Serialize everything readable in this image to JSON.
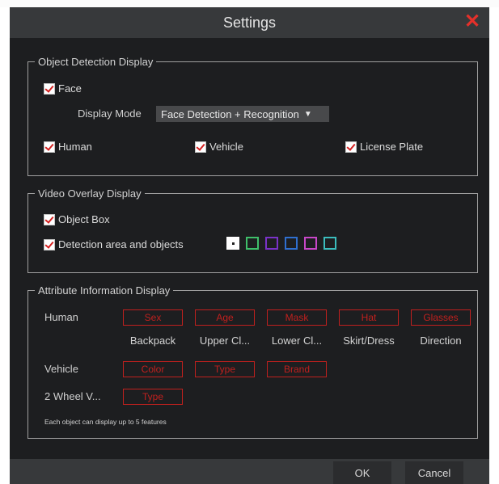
{
  "dialog": {
    "title": "Settings",
    "close_symbol": "✕"
  },
  "object_detection": {
    "legend": "Object Detection Display",
    "face_label": "Face",
    "display_mode_label": "Display Mode",
    "display_mode_value": "Face Detection + Recognition",
    "human_label": "Human",
    "vehicle_label": "Vehicle",
    "license_plate_label": "License Plate"
  },
  "video_overlay": {
    "legend": "Video Overlay Display",
    "object_box_label": "Object Box",
    "detection_area_label": "Detection area and objects",
    "swatch_colors": [
      "#ffffff",
      "#3fbf6a",
      "#7a32c8",
      "#2f6fd0",
      "#c847c8",
      "#3bbdbd"
    ]
  },
  "attributes": {
    "legend": "Attribute Information Display",
    "human_label": "Human",
    "human_selected": [
      "Sex",
      "Age",
      "Mask",
      "Hat",
      "Glasses"
    ],
    "human_unselected": [
      "Backpack",
      "Upper Cl...",
      "Lower Cl...",
      "Skirt/Dress",
      "Direction"
    ],
    "vehicle_label": "Vehicle",
    "vehicle_selected": [
      "Color",
      "Type",
      "Brand"
    ],
    "two_wheel_label": "2 Wheel V...",
    "two_wheel_selected": [
      "Type"
    ],
    "note": "Each object can display up to 5 features"
  },
  "footer": {
    "ok_label": "OK",
    "cancel_label": "Cancel"
  },
  "colors": {
    "accent_red": "#c0201e",
    "background": "#1d1e20",
    "bar": "#37393b"
  }
}
